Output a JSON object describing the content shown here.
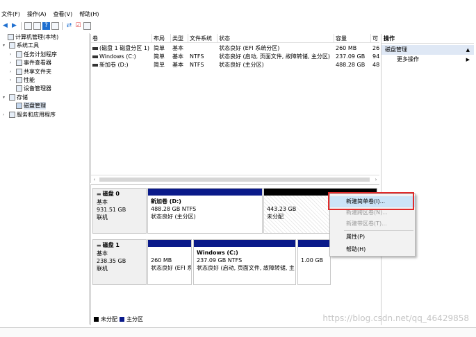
{
  "menu": [
    "文件(F)",
    "操作(A)",
    "查看(V)",
    "帮助(H)"
  ],
  "toolbar_icons": [
    "back-arrow-icon",
    "forward-arrow-icon",
    "folder-up-icon",
    "properties-icon",
    "help-icon",
    "refresh-icon",
    "export-icon",
    "checklist-icon",
    "settings-icon"
  ],
  "tree": [
    {
      "label": "计算机管理(本地)",
      "icon": "computer-management-icon",
      "level": 0,
      "expander": ""
    },
    {
      "label": "系统工具",
      "icon": "tools-icon",
      "level": 1,
      "expander": "▾"
    },
    {
      "label": "任务计划程序",
      "icon": "clock-icon",
      "level": 2,
      "expander": "›"
    },
    {
      "label": "事件查看器",
      "icon": "event-viewer-icon",
      "level": 2,
      "expander": "›"
    },
    {
      "label": "共享文件夹",
      "icon": "shared-folder-icon",
      "level": 2,
      "expander": "›"
    },
    {
      "label": "性能",
      "icon": "performance-icon",
      "level": 2,
      "expander": "›"
    },
    {
      "label": "设备管理器",
      "icon": "device-manager-icon",
      "level": 2,
      "expander": ""
    },
    {
      "label": "存储",
      "icon": "storage-icon",
      "level": 1,
      "expander": "▾"
    },
    {
      "label": "磁盘管理",
      "icon": "disk-management-icon",
      "level": 2,
      "expander": "",
      "selected": true
    },
    {
      "label": "服务和应用程序",
      "icon": "services-icon",
      "level": 1,
      "expander": "›"
    }
  ],
  "columns": [
    "卷",
    "布局",
    "类型",
    "文件系统",
    "状态",
    "容量",
    "可"
  ],
  "volumes": [
    [
      "(磁盘 1 磁盘分区 1)",
      "简单",
      "基本",
      "",
      "状态良好 (EFI 系统分区)",
      "260 MB",
      "26"
    ],
    [
      "Windows (C:)",
      "简单",
      "基本",
      "NTFS",
      "状态良好 (启动, 页面文件, 故障转储, 主分区)",
      "237.09 GB",
      "94"
    ],
    [
      "新加卷 (D:)",
      "简单",
      "基本",
      "NTFS",
      "状态良好 (主分区)",
      "488.28 GB",
      "48"
    ]
  ],
  "actions": {
    "title": "操作",
    "section": "磁盘管理",
    "section_arrow": "▲",
    "more": "更多操作",
    "more_arrow": "▶"
  },
  "disks": [
    {
      "name": "磁盘 0",
      "type": "基本",
      "size": "931.51 GB",
      "status": "联机",
      "partitions": [
        {
          "name": "新加卷 (D:)",
          "size": "488.28 GB NTFS",
          "status": "状态良好 (主分区)"
        },
        {
          "name": "",
          "size": "443.23 GB",
          "status": "未分配"
        }
      ]
    },
    {
      "name": "磁盘 1",
      "type": "基本",
      "size": "238.35 GB",
      "status": "联机",
      "partitions": [
        {
          "name": "",
          "size": "260 MB",
          "status": "状态良好 (EFI 系"
        },
        {
          "name": "Windows (C:)",
          "size": "237.09 GB NTFS",
          "status": "状态良好 (启动, 页面文件, 故障转储, 主"
        },
        {
          "name": "",
          "size": "1.00 GB",
          "status": ""
        }
      ]
    }
  ],
  "legend": [
    {
      "label": "未分配",
      "color": "#000000"
    },
    {
      "label": "主分区",
      "color": "#0a1a8a"
    }
  ],
  "context_menu": [
    {
      "label": "新建简单卷(I)...",
      "state": "hover"
    },
    {
      "label": "新建跨区卷(N)...",
      "state": "disabled"
    },
    {
      "label": "新建带区卷(T)...",
      "state": "disabled"
    },
    {
      "label": "属性(P)",
      "state": "normal"
    },
    {
      "label": "帮助(H)",
      "state": "normal"
    }
  ],
  "watermark": "https://blog.csdn.net/qq_46429858",
  "colors": {
    "primary_partition": "#0a1a8a",
    "unallocated": "#000000",
    "highlight": "#e12b2b",
    "selection": "#dfe8f5"
  }
}
